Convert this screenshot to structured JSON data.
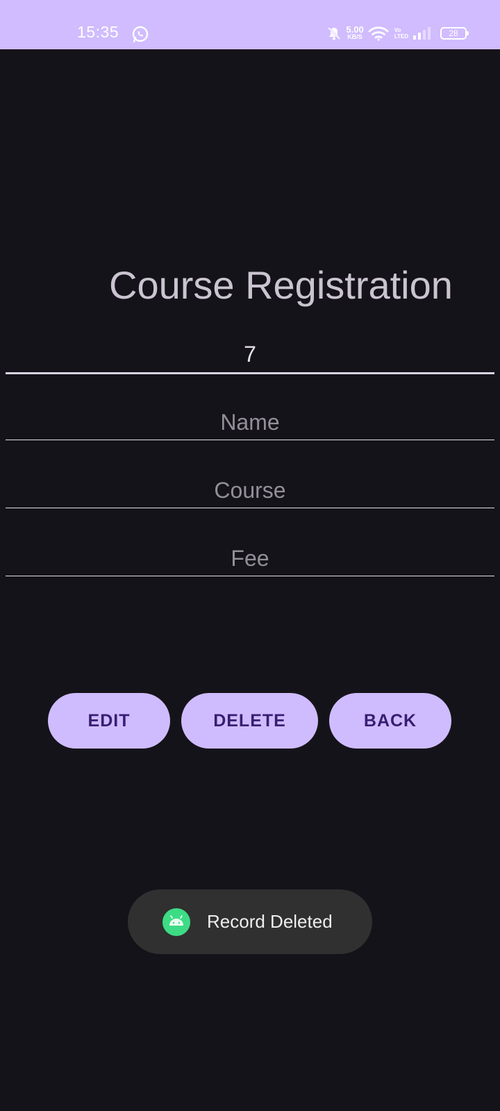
{
  "status_bar": {
    "time": "15:35",
    "net_speed_value": "5.00",
    "net_speed_unit": "KB/S",
    "volte_top": "Vo",
    "volte_bottom": "LTED",
    "battery": "28",
    "background_color": "#d0bcfe"
  },
  "page": {
    "title": "Course Registration",
    "background_color": "#15131a"
  },
  "form": {
    "id_value": "7",
    "name_placeholder": "Name",
    "course_placeholder": "Course",
    "fee_placeholder": "Fee"
  },
  "buttons": {
    "edit_label": "EDIT",
    "delete_label": "DELETE",
    "back_label": "BACK",
    "accent_color": "#cfbcff"
  },
  "toast": {
    "message": "Record Deleted",
    "icon": "android-icon"
  }
}
